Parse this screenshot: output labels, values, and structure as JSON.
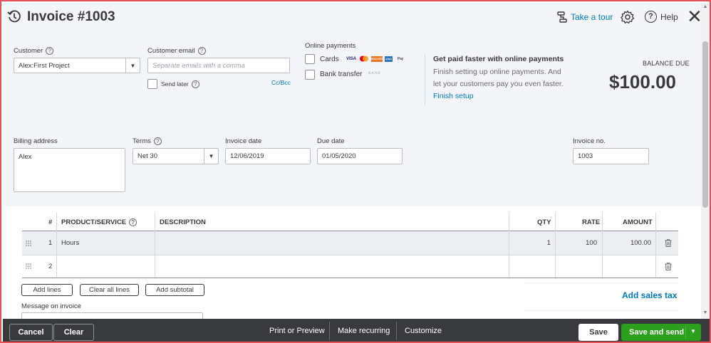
{
  "header": {
    "title": "Invoice #1003",
    "take_tour": "Take a tour",
    "help": "Help"
  },
  "customer": {
    "label": "Customer",
    "value": "Alex:First Project"
  },
  "customer_email": {
    "label": "Customer email",
    "placeholder": "Separate emails with a comma",
    "cc_bcc": "Cc/Bcc",
    "send_later": "Send later"
  },
  "online_payments": {
    "label": "Online payments",
    "cards": "Cards",
    "bank_transfer": "Bank transfer",
    "card_logos": [
      "VISA",
      "MC",
      "DISCOVER",
      "AMEX",
      "Pay"
    ],
    "bank_logo": "BANK"
  },
  "promo": {
    "heading": "Get paid faster with online payments",
    "line1": "Finish setting up online payments. And",
    "line2": "let your customers pay you even faster.",
    "link": "Finish setup"
  },
  "balance": {
    "label": "BALANCE DUE",
    "amount": "$100.00"
  },
  "billing": {
    "label": "Billing address",
    "value": "Alex"
  },
  "terms": {
    "label": "Terms",
    "value": "Net 30"
  },
  "invoice_date": {
    "label": "Invoice date",
    "value": "12/06/2019"
  },
  "due_date": {
    "label": "Due date",
    "value": "01/05/2020"
  },
  "invoice_no": {
    "label": "Invoice no.",
    "value": "1003"
  },
  "table": {
    "headers": {
      "num": "#",
      "product": "PRODUCT/SERVICE",
      "description": "DESCRIPTION",
      "qty": "QTY",
      "rate": "RATE",
      "amount": "AMOUNT"
    },
    "rows": [
      {
        "num": "1",
        "product": "Hours",
        "description": "",
        "qty": "1",
        "rate": "100",
        "amount": "100.00"
      },
      {
        "num": "2",
        "product": "",
        "description": "",
        "qty": "",
        "rate": "",
        "amount": ""
      }
    ]
  },
  "table_actions": {
    "add_lines": "Add lines",
    "clear_all_lines": "Clear all lines",
    "add_subtotal": "Add subtotal",
    "add_sales_tax": "Add sales tax"
  },
  "message": {
    "label": "Message on invoice"
  },
  "footer": {
    "cancel": "Cancel",
    "clear": "Clear",
    "print_preview": "Print or Preview",
    "make_recurring": "Make recurring",
    "customize": "Customize",
    "save": "Save",
    "save_and_send": "Save and send"
  },
  "colors": {
    "accent": "#0077c5",
    "primary_button": "#2ca01c",
    "footer_bg": "#393a3d",
    "window_border": "#e5525a"
  }
}
